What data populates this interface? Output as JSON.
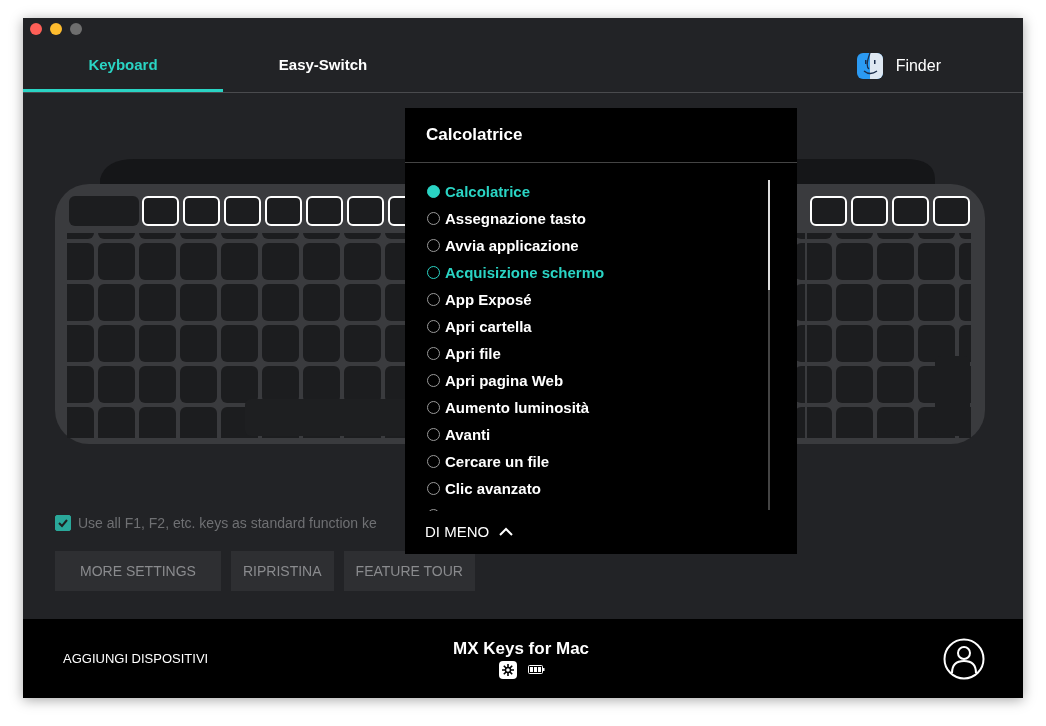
{
  "tabs": [
    {
      "label": "Keyboard",
      "selected": true
    },
    {
      "label": "Easy-Switch",
      "selected": false
    }
  ],
  "app": {
    "label": "Finder"
  },
  "fkeys_left": [
    {
      "selected": true
    },
    {
      "selected": true
    },
    {
      "selected": true
    },
    {
      "selected": true
    },
    {
      "selected": true
    },
    {
      "selected": true
    },
    {
      "selected": true
    }
  ],
  "fkeys_right": [
    {
      "selected": true
    },
    {
      "selected": true
    },
    {
      "selected": true
    },
    {
      "selected": true
    }
  ],
  "function_keys_option": {
    "label": "Use all F1, F2, etc. keys as standard function ke",
    "checked": true
  },
  "buttons": [
    "MORE SETTINGS",
    "RIPRISTINA",
    "FEATURE TOUR"
  ],
  "action_menu": {
    "title": "Calcolatrice",
    "items": [
      {
        "label": "Calcolatrice",
        "selected": true,
        "hovered": false
      },
      {
        "label": "Assegnazione tasto",
        "selected": false,
        "hovered": false
      },
      {
        "label": "Avvia applicazione",
        "selected": false,
        "hovered": false
      },
      {
        "label": "Acquisizione schermo",
        "selected": false,
        "hovered": true
      },
      {
        "label": "App Exposé",
        "selected": false,
        "hovered": false
      },
      {
        "label": "Apri cartella",
        "selected": false,
        "hovered": false
      },
      {
        "label": "Apri file",
        "selected": false,
        "hovered": false
      },
      {
        "label": "Apri pagina Web",
        "selected": false,
        "hovered": false
      },
      {
        "label": "Aumento luminosità",
        "selected": false,
        "hovered": false
      },
      {
        "label": "Avanti",
        "selected": false,
        "hovered": false
      },
      {
        "label": "Cercare un file",
        "selected": false,
        "hovered": false
      },
      {
        "label": "Clic avanzato",
        "selected": false,
        "hovered": false
      }
    ],
    "toggle": "DI MENO"
  },
  "footer": {
    "add_devices": "AGGIUNGI DISPOSITIVI",
    "device_name": "MX Keys for Mac"
  }
}
